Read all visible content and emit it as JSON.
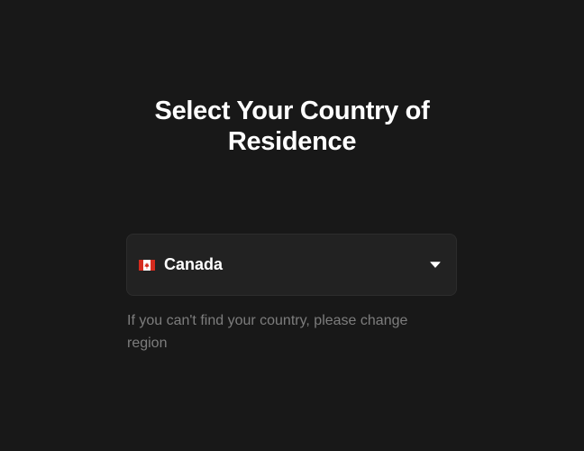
{
  "heading": {
    "line1": "Select Your Country of",
    "line2": "Residence"
  },
  "country_select": {
    "selected_value": "Canada",
    "flag_icon": "canada-flag-icon",
    "caret_icon": "caret-down-icon"
  },
  "helper_text": "If you can't find your country, please change region",
  "colors": {
    "background": "#181818",
    "select_background": "#222222",
    "heading_text": "#ffffff",
    "helper_text": "#7d7d7d",
    "flag_red": "#d52b1e"
  }
}
